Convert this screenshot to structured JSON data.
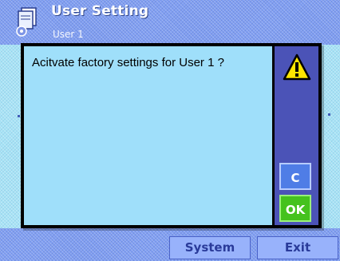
{
  "header": {
    "title": "User Setting",
    "subtitle": "User 1",
    "icon": "user-settings-icon"
  },
  "dialog": {
    "message": "Acitvate factory settings for User 1 ?",
    "warning_icon": "warning-icon",
    "cancel_label": "C",
    "ok_label": "OK"
  },
  "softkeys": {
    "system_label": "System",
    "exit_label": "Exit"
  },
  "colors": {
    "accent": "#4b53b7",
    "dialog_bg": "#9fdffa",
    "ok_green": "#45c21e",
    "cancel_blue": "#4f7de6",
    "warning_yellow": "#ffe500"
  }
}
